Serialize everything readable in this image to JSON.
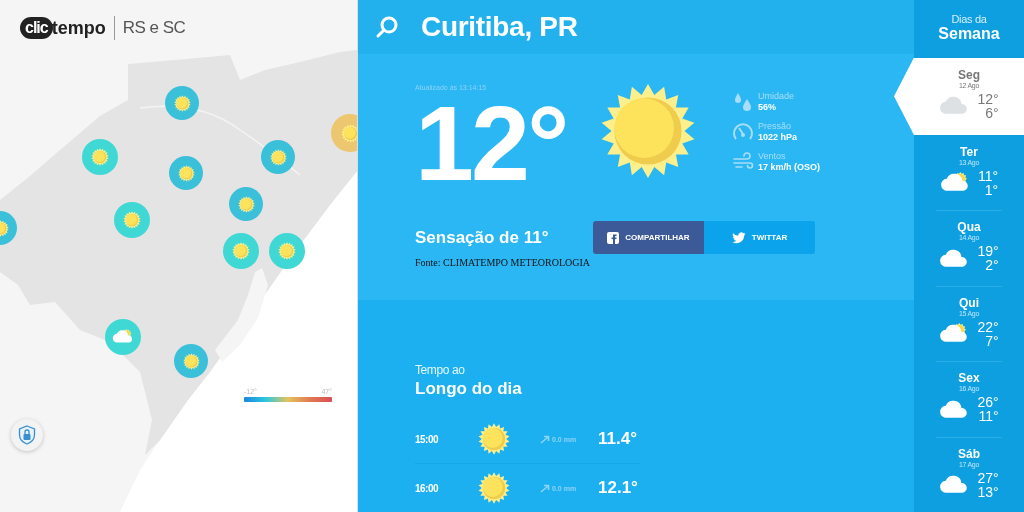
{
  "brand": {
    "logo_mark": "clic",
    "logo_word": "tempo",
    "region": "RS e SC"
  },
  "map": {
    "markers": [
      {
        "kind": "sun",
        "color": "#3bc0d9"
      },
      {
        "kind": "sun",
        "color": "#40d8d4"
      },
      {
        "kind": "sun",
        "color": "#3bc0d9"
      },
      {
        "kind": "sun",
        "color": "#3bc0d9"
      },
      {
        "kind": "sun",
        "color": "#40d8d4"
      },
      {
        "kind": "sun",
        "color": "#3bc0d9"
      },
      {
        "kind": "sun",
        "color": "#40d8d4"
      },
      {
        "kind": "sun",
        "color": "#40d8d4"
      },
      {
        "kind": "partly_cloudy",
        "color": "#40d8d4"
      },
      {
        "kind": "sun",
        "color": "#3bc0d9"
      },
      {
        "kind": "sun",
        "color": "#3bc0d9"
      },
      {
        "kind": "sun",
        "color": "#edc670"
      }
    ],
    "legend": {
      "min": "-12°",
      "max": "47°"
    }
  },
  "header": {
    "city": "Curitiba, PR"
  },
  "current": {
    "updated": "Atualizado às 13:14:15",
    "temperature": "12°",
    "kind": "sun",
    "stats": [
      {
        "kind": "humidity",
        "label": "Umidade",
        "value": "56%"
      },
      {
        "kind": "pressure",
        "label": "Pressão",
        "value": "1022 hPa"
      },
      {
        "kind": "wind",
        "label": "Ventos",
        "value": "17 km/h (OSO)"
      }
    ],
    "feels_like": "Sensação de 11°",
    "share_buttons": [
      {
        "kind": "facebook",
        "label": "COMPARTILHAR"
      },
      {
        "kind": "twitter",
        "label": "TWITTAR"
      }
    ],
    "source": "Fonte: CLIMATEMPO METEOROLOGIA"
  },
  "hourly": {
    "subtitle": "Tempo ao",
    "title": "Longo do dia",
    "rows": [
      {
        "time": "15:00",
        "kind": "sun",
        "rain": "0.0 mm",
        "temperature": "11.4°"
      },
      {
        "time": "16:00",
        "kind": "sun",
        "rain": "0.0 mm",
        "temperature": "12.1°"
      }
    ]
  },
  "week": {
    "subtitle": "Dias da",
    "title": "Semana",
    "days": [
      {
        "day": "Seg",
        "date": "12 Ago",
        "kind": "cloudy",
        "max": "12°",
        "min": "6°",
        "selected": true
      },
      {
        "day": "Ter",
        "date": "13 Ago",
        "kind": "partly_cloudy",
        "max": "11°",
        "min": "1°",
        "selected": false
      },
      {
        "day": "Qua",
        "date": "14 Ago",
        "kind": "cloudy",
        "max": "19°",
        "min": "2°",
        "selected": false
      },
      {
        "day": "Qui",
        "date": "15 Ago",
        "kind": "partly_cloudy",
        "max": "22°",
        "min": "7°",
        "selected": false
      },
      {
        "day": "Sex",
        "date": "16 Ago",
        "kind": "cloudy",
        "max": "26°",
        "min": "11°",
        "selected": false
      },
      {
        "day": "Sáb",
        "date": "17 Ago",
        "kind": "cloudy",
        "max": "27°",
        "min": "13°",
        "selected": false
      }
    ]
  }
}
